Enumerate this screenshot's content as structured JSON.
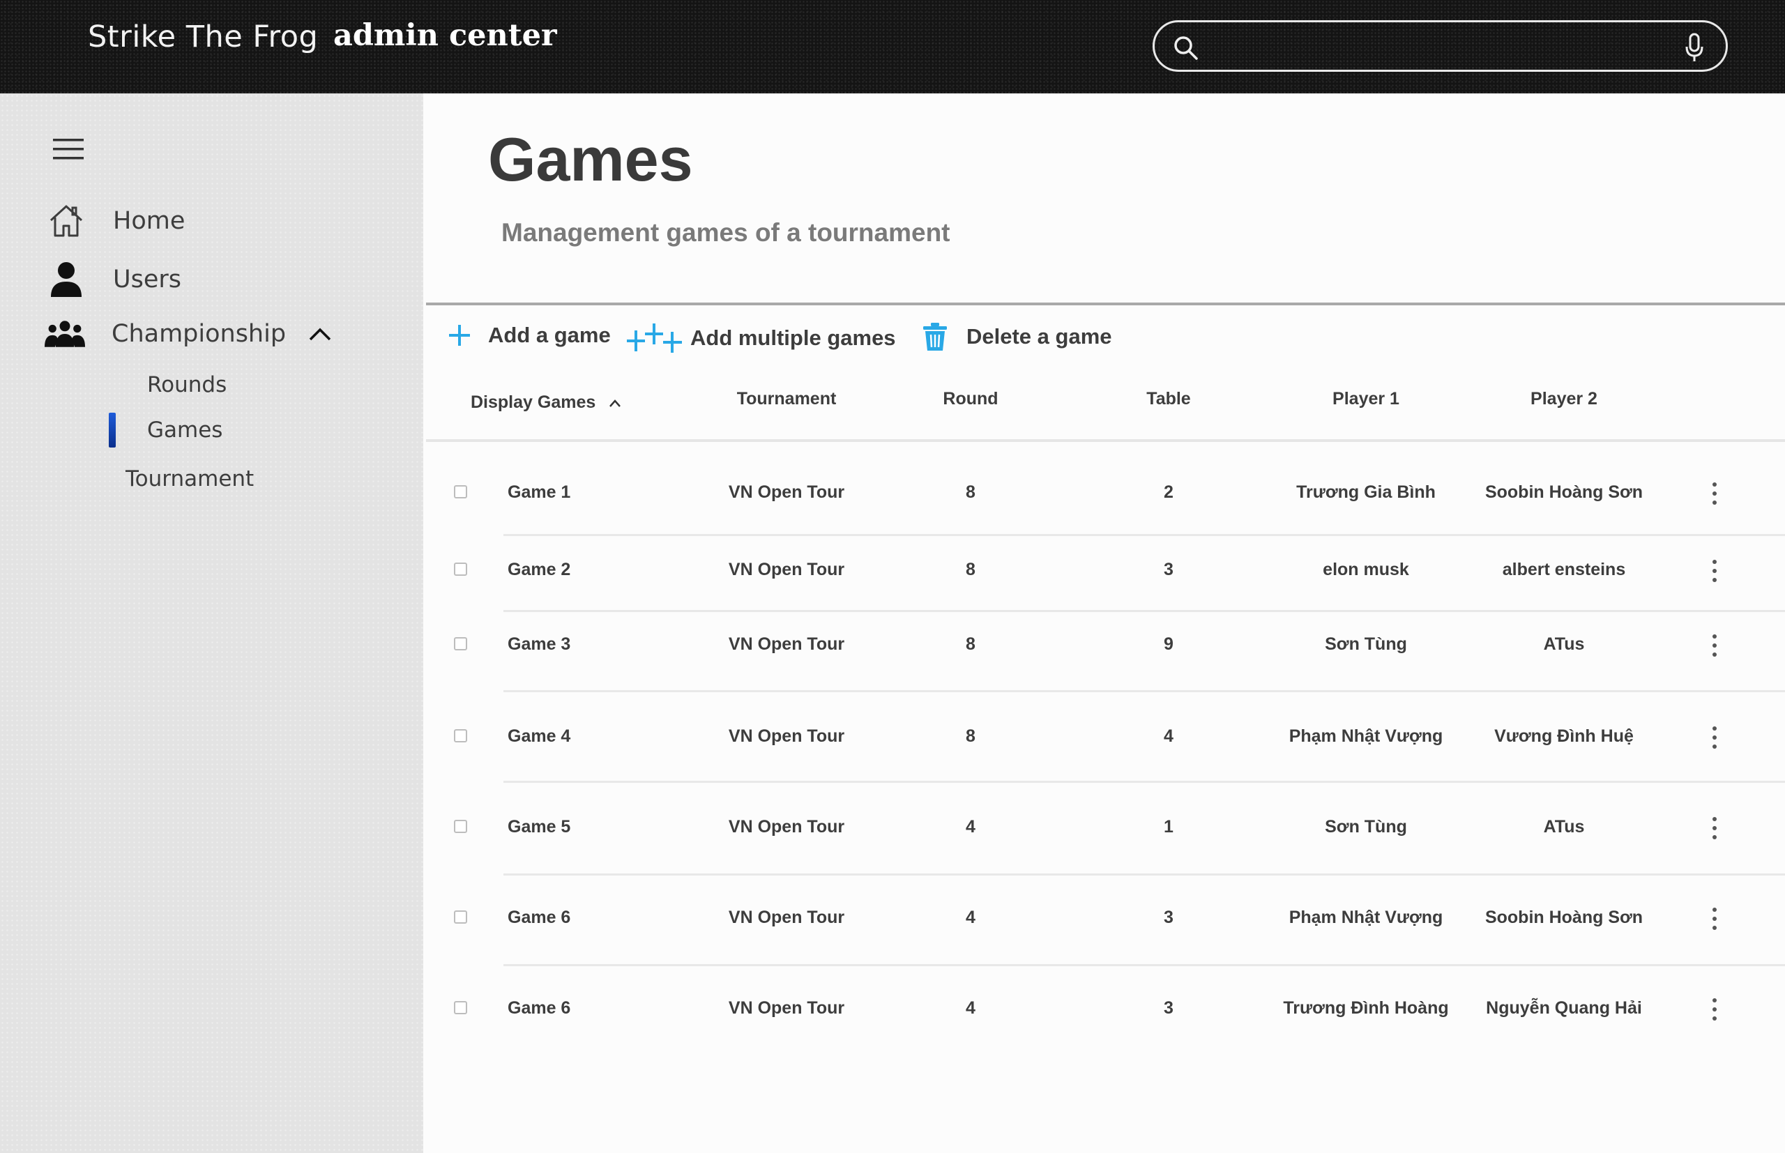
{
  "header": {
    "brand": "Strike The Frog",
    "brand_sub": "admin center",
    "search": {
      "placeholder": "",
      "value": "",
      "search_icon": "search-icon",
      "mic_icon": "microphone-icon"
    }
  },
  "sidebar": {
    "menu_icon": "hamburger-menu-icon",
    "items": [
      {
        "label": "Home",
        "icon": "home-icon"
      },
      {
        "label": "Users",
        "icon": "user-icon"
      },
      {
        "label": "Championship",
        "icon": "group-icon",
        "expanded": true
      }
    ],
    "sub_items": [
      {
        "label": "Rounds"
      },
      {
        "label": "Games",
        "active": true
      },
      {
        "label": "Tournament"
      }
    ],
    "active_color": "#1e5bd9"
  },
  "main": {
    "title": "Games",
    "subtitle": "Management games of a tournament",
    "actions": {
      "add": "Add a game",
      "add_multiple": "Add multiple games",
      "delete": "Delete a game"
    },
    "accent_color": "#29a8e6",
    "columns": {
      "display": "Display Games",
      "tournament": "Tournament",
      "round": "Round",
      "table": "Table",
      "player1": "Player 1",
      "player2": "Player 2"
    },
    "rows": [
      {
        "game": "Game 1",
        "tournament": "VN Open Tour",
        "round": "8",
        "table": "2",
        "player1": "Trương Gia Bình",
        "player2": "Soobin Hoàng Sơn"
      },
      {
        "game": "Game 2",
        "tournament": "VN Open Tour",
        "round": "8",
        "table": "3",
        "player1": "elon musk",
        "player2": "albert ensteins"
      },
      {
        "game": "Game 3",
        "tournament": "VN Open Tour",
        "round": "8",
        "table": "9",
        "player1": "Sơn Tùng",
        "player2": "ATus"
      },
      {
        "game": "Game 4",
        "tournament": "VN Open Tour",
        "round": "8",
        "table": "4",
        "player1": "Phạm Nhật Vượng",
        "player2": "Vương Đình Huệ"
      },
      {
        "game": "Game 5",
        "tournament": "VN Open Tour",
        "round": "4",
        "table": "1",
        "player1": "Sơn Tùng",
        "player2": "ATus"
      },
      {
        "game": "Game 6",
        "tournament": "VN Open Tour",
        "round": "4",
        "table": "3",
        "player1": "Phạm Nhật Vượng",
        "player2": "Soobin Hoàng Sơn"
      },
      {
        "game": "Game 6",
        "tournament": "VN Open Tour",
        "round": "4",
        "table": "3",
        "player1": "Trương Đình Hoàng",
        "player2": "Nguyễn Quang Hải"
      }
    ]
  }
}
